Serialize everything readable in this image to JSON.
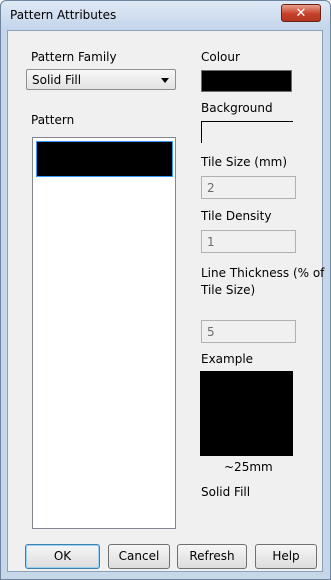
{
  "window": {
    "title": "Pattern Attributes",
    "close_glyph": "✕"
  },
  "pattern_family": {
    "label": "Pattern Family",
    "selected": "Solid Fill"
  },
  "pattern": {
    "label": "Pattern",
    "items": [
      {
        "color": "#000000",
        "selected": true
      }
    ]
  },
  "colour": {
    "label": "Colour",
    "value": "#000000"
  },
  "background": {
    "label": "Background"
  },
  "tile_size": {
    "label": "Tile Size (mm)",
    "value": "2"
  },
  "tile_density": {
    "label": "Tile Density",
    "value": "1"
  },
  "line_thickness": {
    "label_line1": "Line Thickness (% of",
    "label_line2": "Tile Size)",
    "value": "5"
  },
  "example": {
    "label": "Example",
    "scale": "~25mm",
    "name": "Solid Fill"
  },
  "buttons": {
    "ok": "OK",
    "cancel": "Cancel",
    "refresh": "Refresh",
    "help": "Help"
  }
}
